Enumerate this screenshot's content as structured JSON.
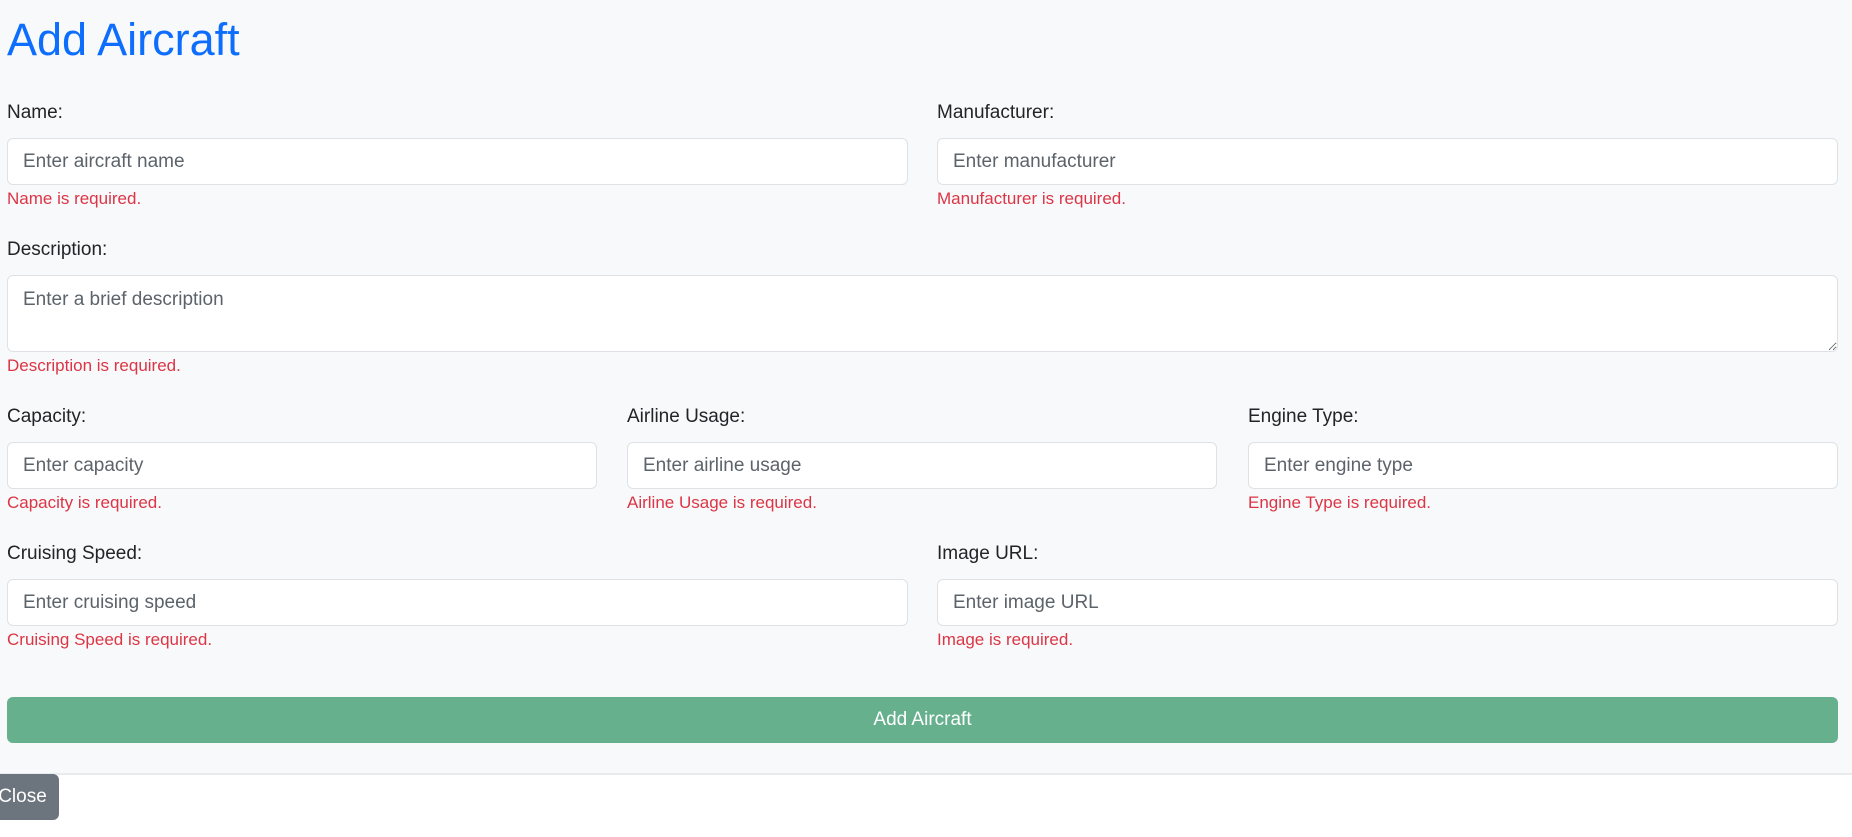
{
  "form": {
    "title": "Add Aircraft",
    "fields": {
      "name": {
        "label": "Name:",
        "placeholder": "Enter aircraft name",
        "value": "",
        "error": "Name is required."
      },
      "manufacturer": {
        "label": "Manufacturer:",
        "placeholder": "Enter manufacturer",
        "value": "",
        "error": "Manufacturer is required."
      },
      "description": {
        "label": "Description:",
        "placeholder": "Enter a brief description",
        "value": "",
        "error": "Description is required."
      },
      "capacity": {
        "label": "Capacity:",
        "placeholder": "Enter capacity",
        "value": "",
        "error": "Capacity is required."
      },
      "airline_usage": {
        "label": "Airline Usage:",
        "placeholder": "Enter airline usage",
        "value": "",
        "error": "Airline Usage is required."
      },
      "engine_type": {
        "label": "Engine Type:",
        "placeholder": "Enter engine type",
        "value": "",
        "error": "Engine Type is required."
      },
      "cruising_speed": {
        "label": "Cruising Speed:",
        "placeholder": "Enter cruising speed",
        "value": "",
        "error": "Cruising Speed is required."
      },
      "image_url": {
        "label": "Image URL:",
        "placeholder": "Enter image URL",
        "value": "",
        "error": "Image is required."
      }
    },
    "submit_label": "Add Aircraft",
    "close_label": "Close"
  },
  "colors": {
    "title": "#0d6efd",
    "error": "#dc3545",
    "submit": "#67b08e",
    "close": "#6c757d",
    "panel_background": "#f8f9fa"
  }
}
